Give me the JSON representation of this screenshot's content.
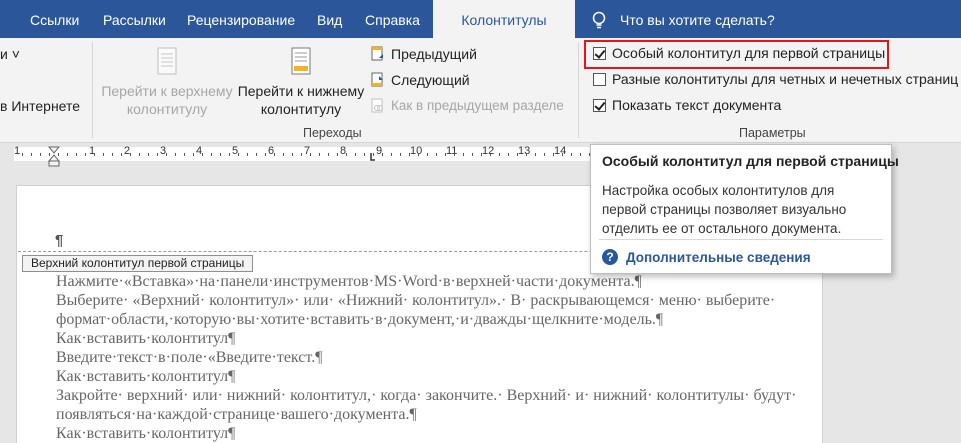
{
  "tabs": [
    {
      "label": "Ссылки"
    },
    {
      "label": "Рассылки"
    },
    {
      "label": "Рецензирование"
    },
    {
      "label": "Вид"
    },
    {
      "label": "Справка"
    },
    {
      "label": "Колонтитулы"
    }
  ],
  "tell_me": "Что вы хотите сделать?",
  "ribbon": {
    "left_cut_1": "и ˅",
    "left_cut_2": "в Интернете",
    "nav": {
      "goto_header_1": "Перейти к верхнему",
      "goto_header_2": "колонтитулу",
      "goto_footer_1": "Перейти к нижнему",
      "goto_footer_2": "колонтитулу",
      "previous": "Предыдущий",
      "next": "Следующий",
      "link_previous": "Как в предыдущем разделе",
      "group_label": "Переходы"
    },
    "options": {
      "different_first": "Особый колонтитул для первой страницы",
      "different_odd_even": "Разные колонтитулы для четных и нечетных страниц",
      "show_doc_text": "Показать текст документа",
      "group_label": "Параметры"
    }
  },
  "ruler_numbers": [
    "1",
    "1",
    "2",
    "3",
    "4",
    "5",
    "6",
    "7",
    "8",
    "9",
    "10",
    "11",
    "12",
    "13",
    "14"
  ],
  "document": {
    "header_tag": "Верхний колонтитул первой страницы",
    "pilcrow": "¶",
    "lines": [
      "Нажмите·«Вставка»·на·панели·инструментов·MS·Word·в·верхней·части·документа.¶",
      "Выберите· «Верхний· колонтитул»· или· «Нижний· колонтитул».· В· раскрывающемся· меню· выберите·",
      "формат·области,·которую·вы·хотите·вставить·в·документ,·и·дважды·щелкните·модель.¶",
      "Как·вставить·колонтитул¶",
      "Введите·текст·в·поле·«Введите·текст.¶",
      "Как·вставить·колонтитул¶",
      "Закройте· верхний· или· нижний· колонтитул,· когда· закончите.· Верхний· и· нижний· колонтитулы· будут·",
      "появляться·на·каждой·странице·вашего·документа.¶",
      "Как·вставить·колонтитул¶"
    ]
  },
  "tooltip": {
    "title": "Особый колонтитул для первой страницы",
    "body_1": "Настройка особых колонтитулов для",
    "body_2": "первой страницы позволяет визуально",
    "body_3": "отделить ее от остального документа.",
    "more": "Дополнительные сведения"
  },
  "colors": {
    "brand": "#2b579a",
    "highlight": "#e8141a"
  }
}
